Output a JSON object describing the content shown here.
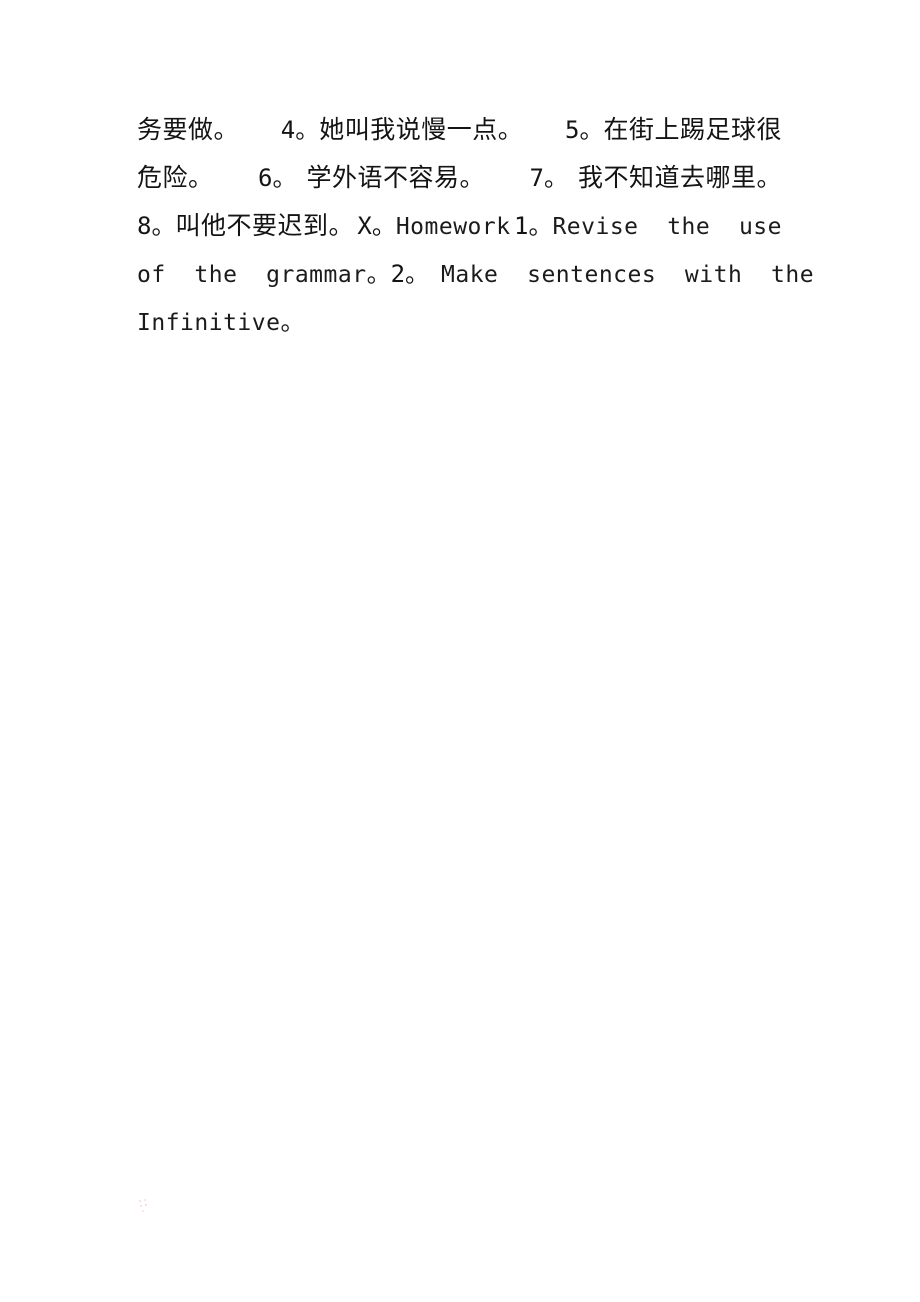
{
  "document": {
    "page_background": "#ffffff",
    "ink_color": "#141414",
    "artifact_color": "#f7b8d8",
    "lines": [
      {
        "id": "line-1",
        "text": "务要做。    4。她叫我说慢一点。    5。在街上踢足球很",
        "segments": [
          {
            "type": "cjk",
            "text": "务要做。"
          },
          {
            "type": "mixed",
            "number": "4",
            "stop": "。",
            "text": "她叫我说慢一点。"
          },
          {
            "type": "mixed",
            "number": "5",
            "stop": "。",
            "text": "在街上踢足球很"
          }
        ]
      },
      {
        "id": "line-2",
        "text": "危险。    6。 学外语不容易。    7。 我不知道去哪里。",
        "segments": [
          {
            "type": "cjk",
            "text": "危险。"
          },
          {
            "type": "mixed",
            "number": "6",
            "stop": "。",
            "text": " 学外语不容易。"
          },
          {
            "type": "mixed",
            "number": "7",
            "stop": "。",
            "text": " 我不知道去哪里。"
          }
        ]
      },
      {
        "id": "line-3",
        "text": "8。叫他不要迟到。   X。Homework   1。Revise the use",
        "segments": [
          {
            "type": "mixed",
            "number": "8",
            "stop": "。",
            "text": "叫他不要迟到。"
          },
          {
            "type": "latin-numbered",
            "number": "X",
            "stop": "。",
            "text": "Homework"
          },
          {
            "type": "latin-numbered",
            "number": "1",
            "stop": "。",
            "text": "Revise the use"
          }
        ]
      },
      {
        "id": "line-4",
        "text": "of the grammar。   2。 Make sentences with the",
        "segments": [
          {
            "type": "latin",
            "text": "of  the  grammar"
          },
          {
            "type": "stop",
            "text": "。"
          },
          {
            "type": "latin-numbered",
            "number": "2",
            "stop": "。",
            "text": "Make  sentences  with  the"
          }
        ]
      },
      {
        "id": "line-5",
        "text": "Infinitive。",
        "segments": [
          {
            "type": "latin",
            "text": "Infinitive"
          },
          {
            "type": "stop",
            "text": "。"
          }
        ]
      }
    ],
    "line_1": {
      "seg_a": "务要做。",
      "seg_b_num": "4",
      "seg_b_stop": "。",
      "seg_b_text": "她叫我说慢一点。",
      "seg_c_num": "5",
      "seg_c_stop": "。",
      "seg_c_text": "在街上踢足球很"
    },
    "line_2": {
      "seg_a": "危险。",
      "seg_b_num": "6",
      "seg_b_stop": "。",
      "seg_b_text": "学外语不容易。",
      "seg_c_num": "7",
      "seg_c_stop": "。",
      "seg_c_text": "我不知道去哪里。"
    },
    "line_3": {
      "seg_a_num": "8",
      "seg_a_stop": "。",
      "seg_a_text": "叫他不要迟到。",
      "seg_b_num": "X",
      "seg_b_stop": "。",
      "seg_b_text": "Homework",
      "seg_c_num": "1",
      "seg_c_stop": "。",
      "seg_c_text": "Revise  the  use"
    },
    "line_4": {
      "seg_a_text": "of  the  grammar",
      "seg_a_stop": "。",
      "seg_b_num": "2",
      "seg_b_stop": "。",
      "seg_b_text": "Make  sentences  with  the"
    },
    "line_5": {
      "seg_a_text": "Infinitive",
      "seg_a_stop": "。"
    }
  }
}
